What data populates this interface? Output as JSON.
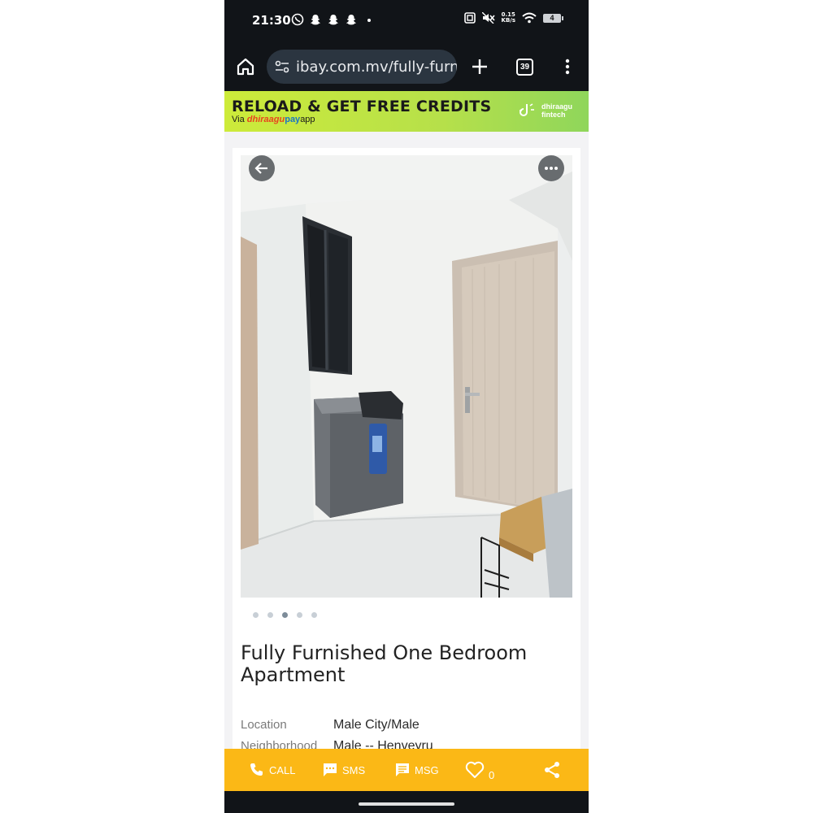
{
  "status_bar": {
    "time": "21:30",
    "left_icons": [
      "viber-icon",
      "snapchat-icon",
      "snapchat-icon",
      "snapchat-icon",
      "dot-icon"
    ],
    "net_speed_value": "0.15",
    "net_speed_unit": "KB/s",
    "battery": "4"
  },
  "browser": {
    "url": "ibay.com.mv/fully-furnis",
    "tab_count": "39"
  },
  "ad": {
    "title": "RELOAD & GET FREE CREDITS",
    "sub_prefix": "Via ",
    "sub_brand": "dhiraagu",
    "sub_pay": "pay",
    "sub_suffix": "app",
    "logo_line1": "dhiraagu",
    "logo_line2": "fintech"
  },
  "listing": {
    "gallery": {
      "image_count": 5,
      "active_index": 2
    },
    "title": "Fully Furnished One Bedroom Apartment",
    "details": [
      {
        "label": "Location",
        "value": "Male City/Male"
      },
      {
        "label": "Neighborhood",
        "value": "Male -- Henveyru"
      }
    ]
  },
  "actions": {
    "call": "CALL",
    "sms": "SMS",
    "msg": "MSG",
    "likes": "0"
  },
  "colors": {
    "action_bar": "#fbb816",
    "status_bar": "#111418",
    "ad_green": "#c4e63f"
  }
}
